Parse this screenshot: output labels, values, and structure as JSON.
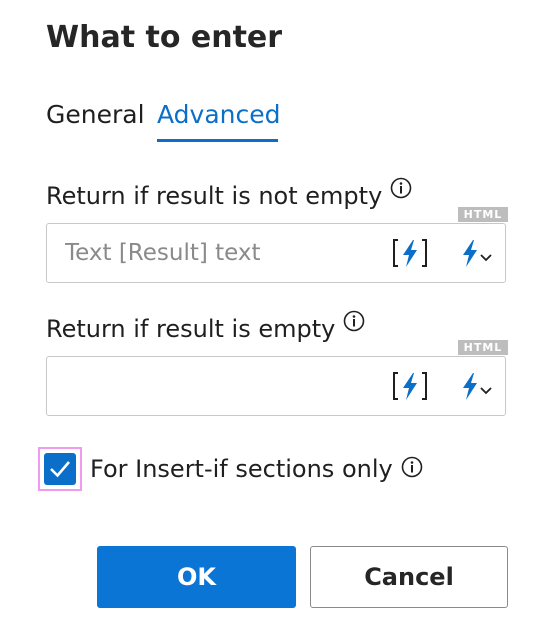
{
  "dialog": {
    "title": "What to enter"
  },
  "tabs": [
    {
      "label": "General",
      "active": false
    },
    {
      "label": "Advanced",
      "active": true
    }
  ],
  "fields": {
    "not_empty": {
      "label": "Return if result is not empty",
      "value": "",
      "placeholder": "Text [Result] text",
      "badge": "HTML"
    },
    "empty": {
      "label": "Return if result is empty",
      "value": "",
      "placeholder": "",
      "badge": "HTML"
    }
  },
  "checkbox": {
    "label": "For Insert-if sections only",
    "checked": true
  },
  "buttons": {
    "ok": "OK",
    "cancel": "Cancel"
  },
  "colors": {
    "accent": "#0b6ec9",
    "focus_outline": "#f09af0",
    "badge": "#bdbdbd"
  },
  "icons": [
    "info-icon",
    "bolt-bracket-icon",
    "bolt-dropdown-icon",
    "checkmark-icon"
  ]
}
